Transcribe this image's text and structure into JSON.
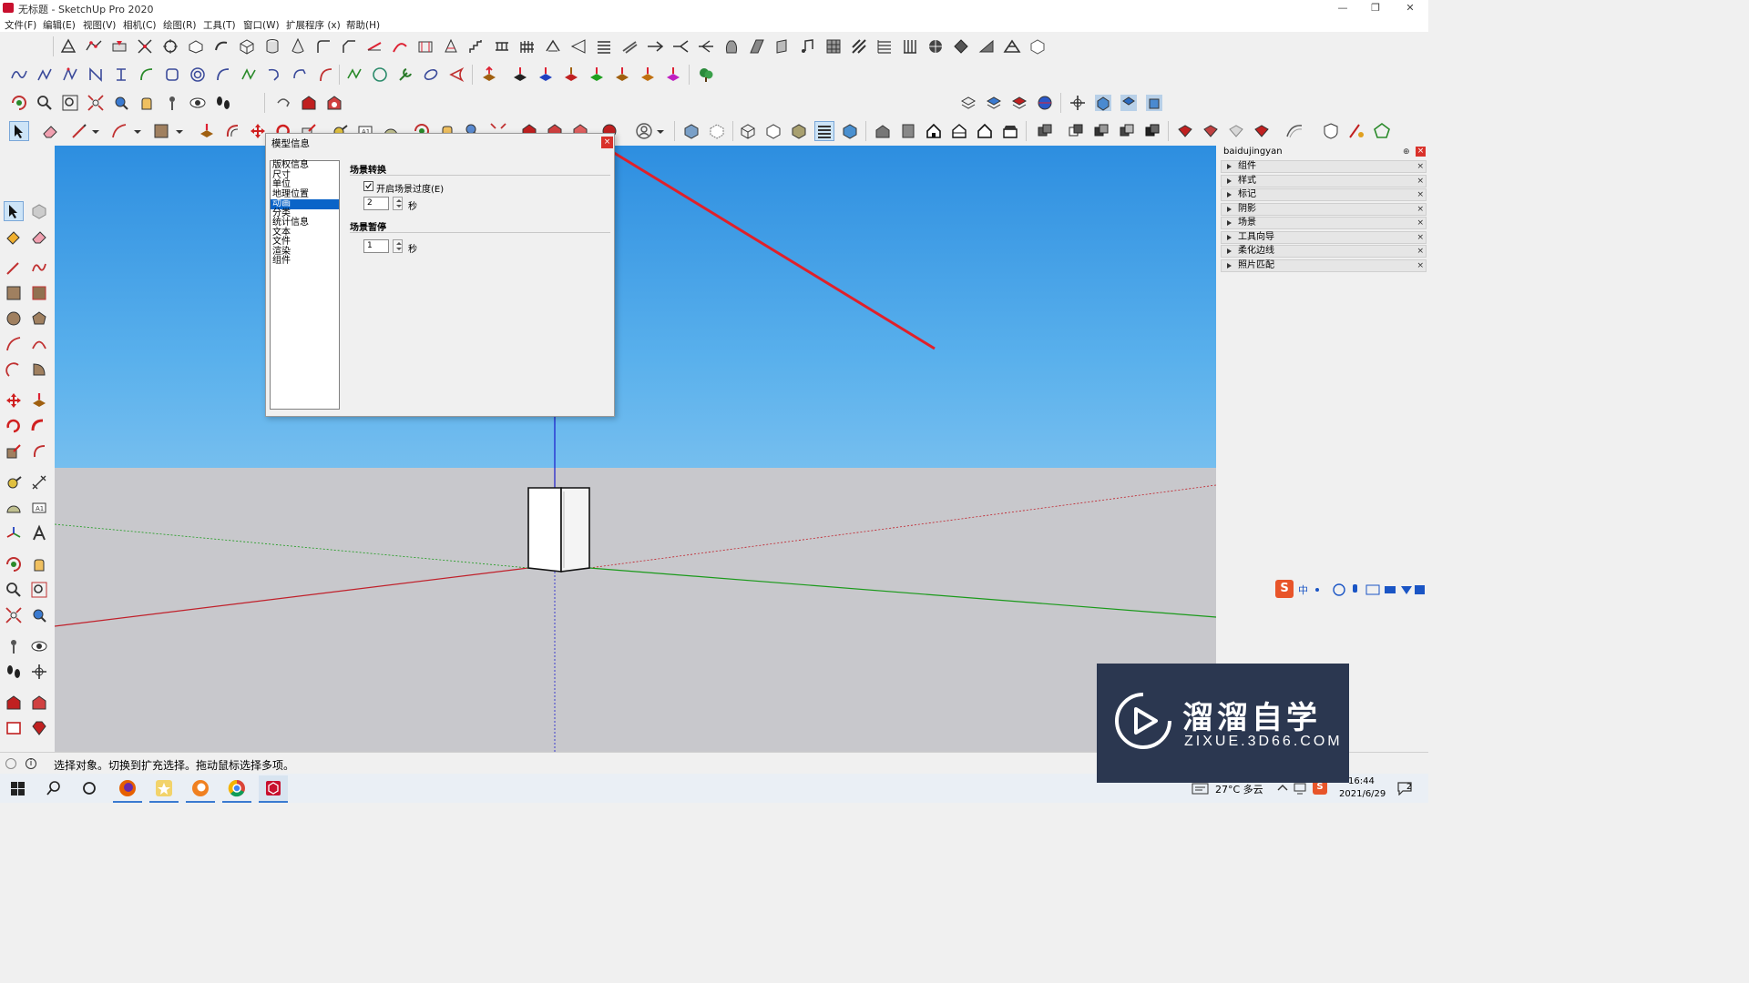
{
  "window": {
    "title": "无标题 - SketchUp Pro 2020",
    "minimize": "—",
    "restore": "❐",
    "close": "✕"
  },
  "menu": [
    "文件(F)",
    "编辑(E)",
    "视图(V)",
    "相机(C)",
    "绘图(R)",
    "工具(T)",
    "窗口(W)",
    "扩展程序 (x)",
    "帮助(H)"
  ],
  "dialog": {
    "title": "模型信息",
    "close": "×",
    "categories": [
      "版权信息",
      "尺寸",
      "单位",
      "地理位置",
      "动画",
      "分类",
      "统计信息",
      "文本",
      "文件",
      "渲染",
      "组件"
    ],
    "selected_index": 4,
    "scene_transition": {
      "heading": "场景转换",
      "checkbox_label": "开启场景过度(E)",
      "checked": true,
      "value": "2",
      "unit": "秒"
    },
    "scene_delay": {
      "heading": "场景暂停",
      "value": "1",
      "unit": "秒"
    }
  },
  "tray": {
    "title": "baidujingyan",
    "items": [
      "组件",
      "样式",
      "标记",
      "阴影",
      "场景",
      "工具向导",
      "柔化边线",
      "照片匹配"
    ]
  },
  "status": {
    "message": "选择对象。切换到扩充选择。拖动鼠标选择多项。"
  },
  "taskbar": {
    "weather": "27°C 多云",
    "time": "16:44",
    "date": "2021/6/29",
    "notify_count": "2"
  },
  "watermark": {
    "brand": "溜溜自学",
    "url": "ZIXUE.3D66.COM"
  },
  "ime": {
    "label": "中"
  },
  "colors": {
    "sky_top": "#2d8ee0",
    "ground": "#c8c8cc",
    "selection": "#0a64c8",
    "annotation_arrow": "#e0202a",
    "red_axis": "#c0202a",
    "green_axis": "#1a9a1a",
    "blue_axis": "#1a1acc"
  }
}
